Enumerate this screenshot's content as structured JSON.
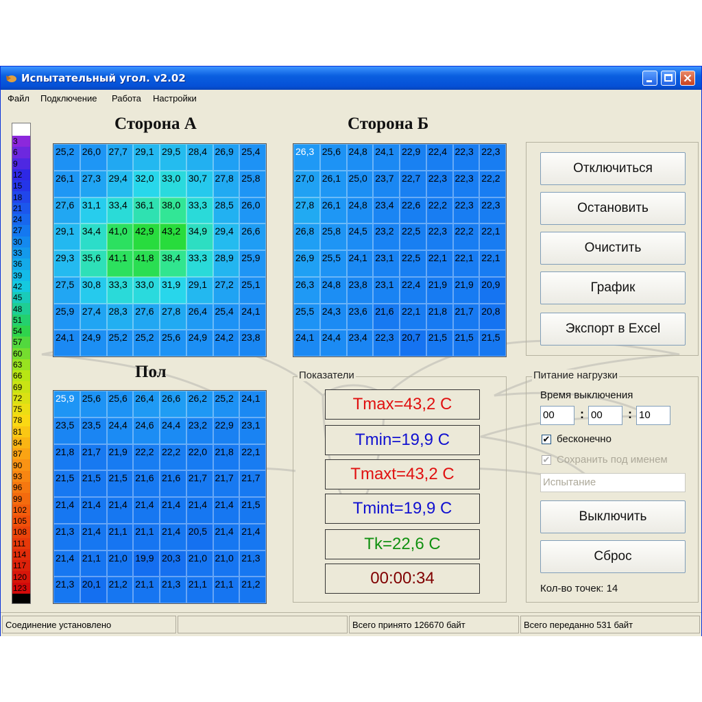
{
  "window": {
    "title": "Испытательный угол. v2.02"
  },
  "menu": [
    "Файл",
    "Подключение",
    "Работа",
    "Настройки"
  ],
  "scale": [
    "3",
    "6",
    "9",
    "12",
    "15",
    "18",
    "21",
    "24",
    "27",
    "30",
    "33",
    "36",
    "39",
    "42",
    "45",
    "48",
    "51",
    "54",
    "57",
    "60",
    "63",
    "66",
    "69",
    "72",
    "75",
    "78",
    "81",
    "84",
    "87",
    "90",
    "93",
    "96",
    "99",
    "102",
    "105",
    "108",
    "111",
    "114",
    "117",
    "120",
    "123"
  ],
  "side_a": {
    "title": "Сторона А",
    "values": [
      [
        "25,2",
        "26,0",
        "27,7",
        "29,1",
        "29,5",
        "28,4",
        "26,9",
        "25,4"
      ],
      [
        "26,1",
        "27,3",
        "29,4",
        "32,0",
        "33,0",
        "30,7",
        "27,8",
        "25,8"
      ],
      [
        "27,6",
        "31,1",
        "33,4",
        "36,1",
        "38,0",
        "33,3",
        "28,5",
        "26,0"
      ],
      [
        "29,1",
        "34,4",
        "41,0",
        "42,9",
        "43,2",
        "34,9",
        "29,4",
        "26,6"
      ],
      [
        "29,3",
        "35,6",
        "41,1",
        "41,8",
        "38,4",
        "33,3",
        "28,9",
        "25,9"
      ],
      [
        "27,5",
        "30,8",
        "33,3",
        "33,0",
        "31,9",
        "29,1",
        "27,2",
        "25,1"
      ],
      [
        "25,9",
        "27,4",
        "28,3",
        "27,6",
        "27,8",
        "26,4",
        "25,4",
        "24,1"
      ],
      [
        "24,1",
        "24,9",
        "25,2",
        "25,2",
        "25,6",
        "24,9",
        "24,2",
        "23,8"
      ]
    ]
  },
  "side_b": {
    "title": "Сторона Б",
    "values": [
      [
        "26,3",
        "25,6",
        "24,8",
        "24,1",
        "22,9",
        "22,4",
        "22,3",
        "22,3"
      ],
      [
        "27,0",
        "26,1",
        "25,0",
        "23,7",
        "22,7",
        "22,3",
        "22,3",
        "22,2"
      ],
      [
        "27,8",
        "26,1",
        "24,8",
        "23,4",
        "22,6",
        "22,2",
        "22,3",
        "22,3"
      ],
      [
        "26,8",
        "25,8",
        "24,5",
        "23,2",
        "22,5",
        "22,3",
        "22,2",
        "22,1"
      ],
      [
        "26,9",
        "25,5",
        "24,1",
        "23,1",
        "22,5",
        "22,1",
        "22,1",
        "22,1"
      ],
      [
        "26,3",
        "24,8",
        "23,8",
        "23,1",
        "22,4",
        "21,9",
        "21,9",
        "20,9"
      ],
      [
        "25,5",
        "24,3",
        "23,6",
        "21,6",
        "22,1",
        "21,8",
        "21,7",
        "20,8"
      ],
      [
        "24,1",
        "24,4",
        "23,4",
        "22,3",
        "20,7",
        "21,5",
        "21,5",
        "21,5"
      ]
    ]
  },
  "floor": {
    "title": "Пол",
    "values": [
      [
        "25,9",
        "25,6",
        "25,6",
        "26,4",
        "26,6",
        "26,2",
        "25,2",
        "24,1"
      ],
      [
        "23,5",
        "23,5",
        "24,4",
        "24,6",
        "24,4",
        "23,2",
        "22,9",
        "23,1"
      ],
      [
        "21,8",
        "21,7",
        "21,9",
        "22,2",
        "22,2",
        "22,0",
        "21,8",
        "22,1"
      ],
      [
        "21,5",
        "21,5",
        "21,5",
        "21,6",
        "21,6",
        "21,7",
        "21,7",
        "21,7"
      ],
      [
        "21,4",
        "21,4",
        "21,4",
        "21,4",
        "21,4",
        "21,4",
        "21,4",
        "21,5"
      ],
      [
        "21,3",
        "21,4",
        "21,1",
        "21,1",
        "21,4",
        "20,5",
        "21,4",
        "21,4"
      ],
      [
        "21,4",
        "21,1",
        "21,0",
        "19,9",
        "20,3",
        "21,0",
        "21,0",
        "21,3"
      ],
      [
        "21,3",
        "20,1",
        "21,2",
        "21,1",
        "21,3",
        "21,1",
        "21,1",
        "21,2"
      ]
    ]
  },
  "controls": {
    "disconnect": "Отключиться",
    "stop": "Остановить",
    "clear": "Очистить",
    "graph": "График",
    "export": "Экспорт в Excel"
  },
  "indicators": {
    "title": "Показатели",
    "tmax": "Tmax=43,2 C",
    "tmin": "Tmin=19,9 C",
    "tmaxt": "Tmaxt=43,2 C",
    "tmint": "Tmint=19,9 C",
    "tk": "Tk=22,6 C",
    "time": "00:00:34"
  },
  "power": {
    "title": "Питание нагрузки",
    "off_time_label": "Время выключения",
    "hh": "00",
    "mm": "00",
    "ss": "10",
    "infinite_label": "бесконечно",
    "infinite_checked": "✔",
    "save_label": "Сохранить под именем",
    "save_checked": "✔",
    "name_placeholder": "Испытание",
    "off_button": "Выключить",
    "reset_button": "Сброс",
    "points_label": "Кол-во точек: 14"
  },
  "status": {
    "connection": "Соединение установлено",
    "blank": "",
    "received": "Всего принято 126670 байт",
    "sent": "Всего переданно 531 байт"
  },
  "colors": {
    "title_bar": "#0550d6",
    "tmax": "#e01010",
    "tmin": "#1010d0",
    "tk": "#109010",
    "time": "#800000"
  }
}
